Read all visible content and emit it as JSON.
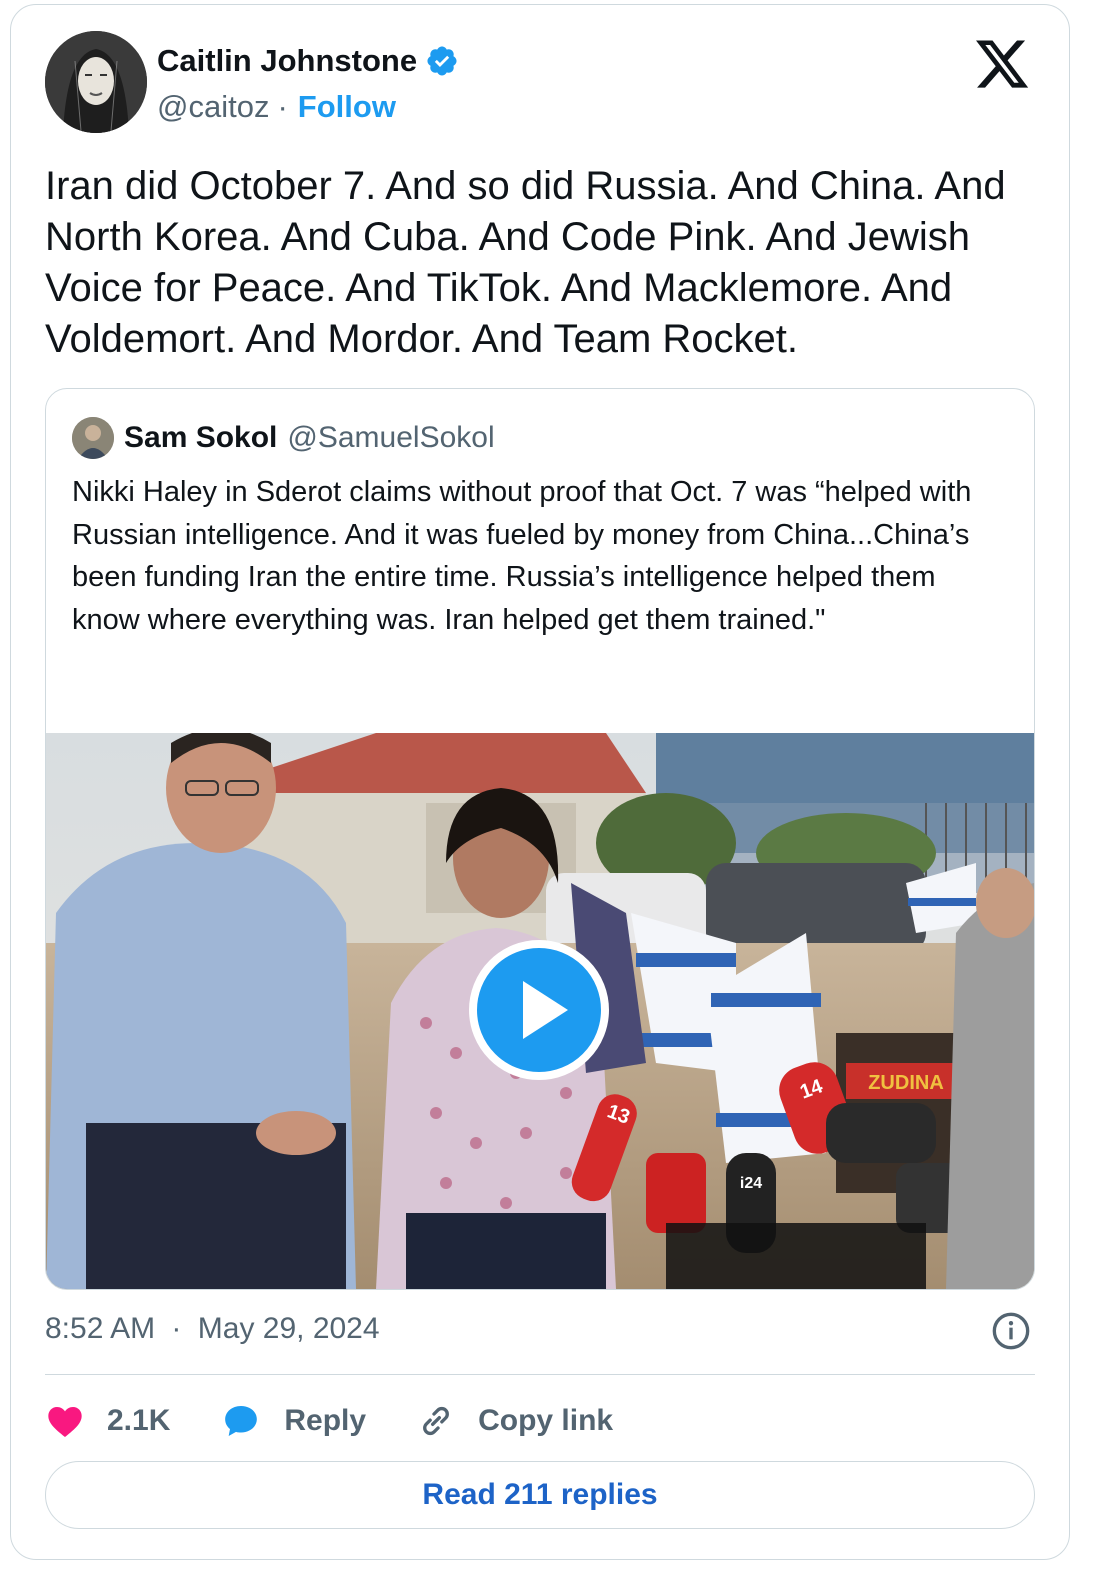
{
  "author": {
    "name": "Caitlin Johnstone",
    "handle": "@caitoz",
    "separator": "·",
    "follow_label": "Follow"
  },
  "tweet": {
    "text": "Iran did October 7. And so did Russia. And China. And North Korea. And Cuba. And Code Pink. And Jewish Voice for Peace. And TikTok. And Macklemore. And Voldemort. And Mordor. And Team Rocket."
  },
  "quoted": {
    "name": "Sam Sokol",
    "handle": "@SamuelSokol",
    "text": "Nikki Haley in Sderot claims without proof that Oct. 7 was “helped with Russian intelligence. And it was fueled by money from China...China’s been funding Iran the entire time. Russia’s intelligence helped them know where everything was. Iran helped get them trained.\"",
    "media": {
      "type": "video",
      "icon": "play-icon",
      "mic_labels": [
        "13",
        "14",
        "i24"
      ],
      "banner_text": "ZUDINA"
    }
  },
  "timestamp": {
    "time": "8:52 AM",
    "separator": "·",
    "date": "May 29, 2024"
  },
  "actions": {
    "likes": "2.1K",
    "reply_label": "Reply",
    "copy_label": "Copy link"
  },
  "read_replies_label": "Read 211 replies",
  "colors": {
    "accent": "#1d9bf0",
    "link": "#1d63c7",
    "heart": "#f91880",
    "text": "#0f1419",
    "muted": "#536471",
    "border": "#cfd9de"
  }
}
